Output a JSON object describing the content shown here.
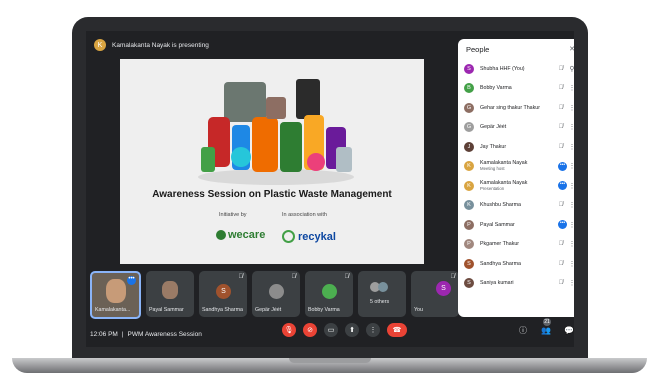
{
  "topbar": {
    "presenter_text": "Kamalakanta Nayak is presenting",
    "presenter_initial": "K"
  },
  "slide": {
    "title": "Awareness Session on Plastic Waste Management",
    "initiative_label": "Initiative by",
    "association_label": "In association with",
    "wecare_logo": "wecare",
    "recykal_logo": "recykal"
  },
  "tiles": [
    {
      "name": "Kamalakanta...",
      "initial": "",
      "color": "#8a6f57",
      "muted": false,
      "self": true
    },
    {
      "name": "Payal Sammar",
      "initial": "",
      "color": "#9a7b66",
      "muted": false
    },
    {
      "name": "Sandhya Sharma",
      "initial": "S",
      "color": "#a0522d",
      "muted": true
    },
    {
      "name": "Gepär Jėėt",
      "initial": "",
      "color": "#8c8c8c",
      "muted": true
    },
    {
      "name": "Bobby Varma",
      "initial": "",
      "color": "#4caf50",
      "muted": true
    },
    {
      "name": "5 others",
      "initial": "",
      "color": "#9e9e9e",
      "muted": false
    },
    {
      "name": "You",
      "initial": "S",
      "color": "#9c27b0",
      "muted": true
    }
  ],
  "bottombar": {
    "time": "12:06 PM",
    "separator": "|",
    "meeting_name": "PWM Awareness Session",
    "participants_badge": "21"
  },
  "people": {
    "title": "People",
    "close_icon": "✕",
    "list": [
      {
        "name": "Shubha HHF (You)",
        "sub": "",
        "initial": "S",
        "color": "#9c27b0",
        "state": "muted",
        "action": "pin"
      },
      {
        "name": "Bobby Varma",
        "sub": "",
        "initial": "B",
        "color": "#43a047",
        "state": "muted",
        "action": "more"
      },
      {
        "name": "Gehar sing thakur Thakur",
        "sub": "",
        "initial": "G",
        "color": "#8d6e63",
        "state": "muted",
        "action": "more"
      },
      {
        "name": "Gepär Jėėt",
        "sub": "",
        "initial": "G",
        "color": "#9e9e9e",
        "state": "muted",
        "action": "more"
      },
      {
        "name": "Jay Thakur",
        "sub": "",
        "initial": "J",
        "color": "#5d4037",
        "state": "muted",
        "action": "more"
      },
      {
        "name": "Kamalakanta Nayak",
        "sub": "Meeting host",
        "initial": "K",
        "color": "#d9a441",
        "state": "speaking",
        "action": "more"
      },
      {
        "name": "Kamalakanta Nayak",
        "sub": "Presentation",
        "initial": "K",
        "color": "#d9a441",
        "state": "speaking",
        "action": "more"
      },
      {
        "name": "Khushbu Sharma",
        "sub": "",
        "initial": "K",
        "color": "#78909c",
        "state": "muted",
        "action": "more"
      },
      {
        "name": "Payal Sammar",
        "sub": "",
        "initial": "P",
        "color": "#8d6e63",
        "state": "speaking",
        "action": "more"
      },
      {
        "name": "Pkgamer Thakur",
        "sub": "",
        "initial": "P",
        "color": "#a1887f",
        "state": "muted",
        "action": "more"
      },
      {
        "name": "Sandhya Sharma",
        "sub": "",
        "initial": "S",
        "color": "#a0522d",
        "state": "muted",
        "action": "more"
      },
      {
        "name": "Saniya kumari",
        "sub": "",
        "initial": "S",
        "color": "#6d4c41",
        "state": "muted",
        "action": "more"
      }
    ]
  }
}
